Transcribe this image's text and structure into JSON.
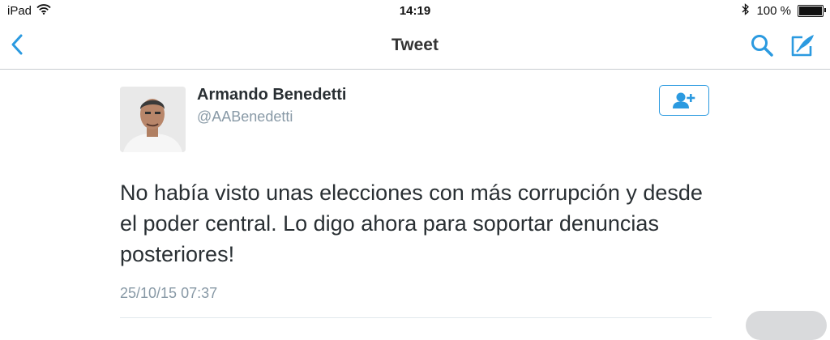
{
  "status_bar": {
    "device": "iPad",
    "time": "14:19",
    "battery": "100 %",
    "icons": [
      "wifi-icon",
      "bluetooth-icon",
      "battery-icon"
    ]
  },
  "nav": {
    "title": "Tweet",
    "icons": [
      "chevron-left-icon",
      "search-icon",
      "compose-icon"
    ],
    "accent_color": "#2b9ae0"
  },
  "tweet": {
    "name": "Armando Benedetti",
    "handle": "@AABenedetti",
    "text": "No había visto unas elecciones con más corrupción y desde el poder central. Lo digo ahora para soportar denuncias posteriores!",
    "timestamp": "25/10/15 07:37",
    "follow_icon": "add-user-icon"
  }
}
